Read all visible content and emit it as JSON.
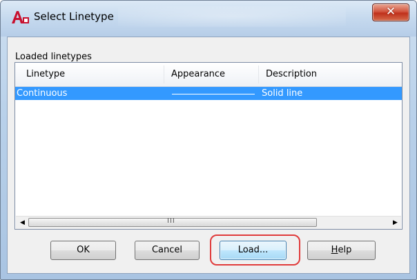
{
  "window": {
    "title": "Select Linetype",
    "app_icon_text": "A",
    "close_glyph": "✕",
    "icons": {
      "app": "autocad-app-icon",
      "close": "close-icon"
    },
    "colors": {
      "selection": "#3399ff",
      "highlight_ring": "#e03a3a",
      "close_red": "#c0301b"
    }
  },
  "group": {
    "label": "Loaded linetypes"
  },
  "list": {
    "columns": [
      "Linetype",
      "Appearance",
      "Description"
    ],
    "rows": [
      {
        "linetype": "Continuous",
        "appearance": "solid-line-sample",
        "description": "Solid line",
        "selected": true
      }
    ]
  },
  "scrollbar": {
    "left_arrow": "◀",
    "right_arrow": "▶",
    "grip": "III"
  },
  "buttons": {
    "ok": "OK",
    "cancel": "Cancel",
    "load": "Load...",
    "help_first": "H",
    "help_rest": "elp"
  }
}
